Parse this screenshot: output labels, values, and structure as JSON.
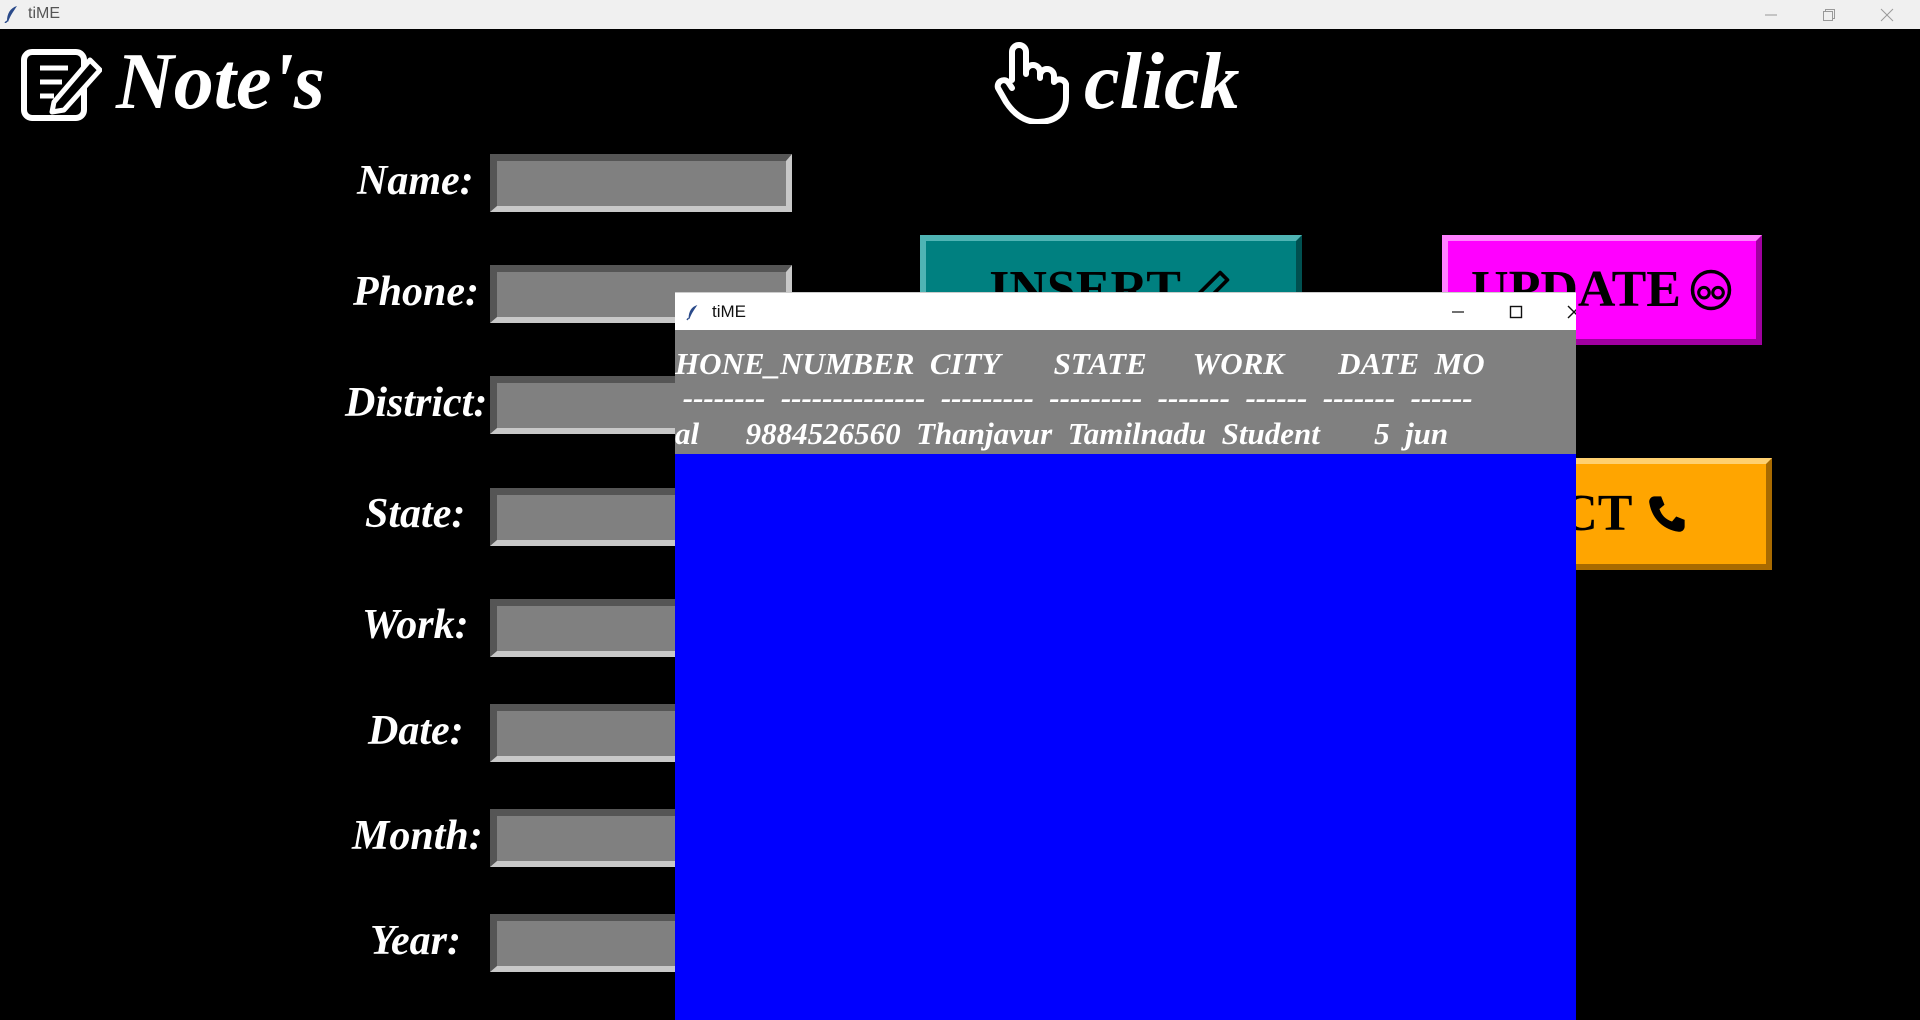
{
  "window": {
    "title": "tiME",
    "controls": [
      "minimize",
      "restore",
      "close"
    ]
  },
  "header": {
    "notes_title": "Note's",
    "notes_icon": "note-edit-icon",
    "click_title": "click",
    "click_icon": "pointing-hand-icon"
  },
  "form": {
    "fields": [
      {
        "label": "Name:",
        "value": ""
      },
      {
        "label": "Phone:",
        "value": ""
      },
      {
        "label": "District:",
        "value": ""
      },
      {
        "label": "State:",
        "value": ""
      },
      {
        "label": "Work:",
        "value": ""
      },
      {
        "label": "Date:",
        "value": ""
      },
      {
        "label": "Month:",
        "value": ""
      },
      {
        "label": "Year:",
        "value": ""
      }
    ]
  },
  "buttons": {
    "insert": {
      "label": "INSERT",
      "icon": "pencil-icon",
      "color": "#008080"
    },
    "update": {
      "label": "UPDATE",
      "icon": "eyes-icon",
      "color": "#ff00ff"
    },
    "select": {
      "label": "ECT",
      "icon": "phone-icon",
      "color": "#ffa500"
    }
  },
  "popup": {
    "title": "tiME",
    "background": "#0000ff",
    "records_background": "#808080",
    "header_line": "HONE_NUMBER  CITY       STATE      WORK       DATE  MO",
    "separator_line": " --------  --------------  ---------  ---------  -------  ------  -------  ------",
    "data_line": "al      9884526560  Thanjavur  Tamilnadu  Student       5  jun"
  }
}
